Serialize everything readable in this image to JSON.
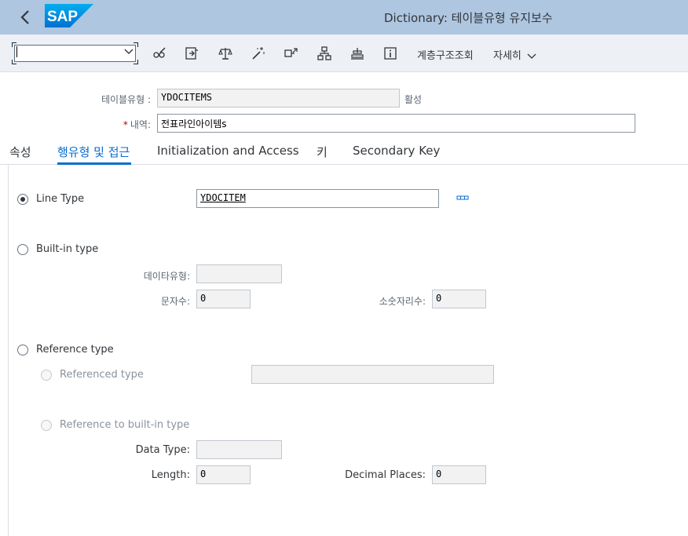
{
  "shell": {
    "title": "Dictionary: 테이블유형 유지보수",
    "logo_text": "SAP"
  },
  "toolbar": {
    "tcode_value": "",
    "icons": [
      "glasses-edit-icon",
      "activate-icon",
      "check-balance-icon",
      "magic-wand-icon",
      "where-used-icon",
      "hierarchy-icon",
      "object-list-icon",
      "info-icon"
    ],
    "hierarchy_label": "계층구조조회",
    "more_label": "자세히"
  },
  "header": {
    "table_type_label": "테이블유형 :",
    "table_type_value": "YDOCITEMS",
    "status": "활성",
    "desc_required": "*",
    "desc_label": "내역:",
    "desc_value": "전표라인아이템s"
  },
  "tabs": [
    {
      "label": "속성"
    },
    {
      "label": "행유형 및 접근"
    },
    {
      "label": "Initialization and Access"
    },
    {
      "label": "키"
    },
    {
      "label": "Secondary Key"
    }
  ],
  "active_tab": 1,
  "line_type": {
    "label": "Line Type",
    "value": "YDOCITEM",
    "selected": true
  },
  "builtin": {
    "label": "Built-in type",
    "data_type_label": "데이타유형:",
    "data_type_value": "",
    "length_label": "문자수:",
    "length_value": "0",
    "decimals_label": "소숫자리수:",
    "decimals_value": "0"
  },
  "reference": {
    "label": "Reference type",
    "referenced_type_label": "Referenced type",
    "referenced_type_value": "",
    "ref_builtin_label": "Reference to built-in type",
    "data_type_label": "Data Type:",
    "data_type_value": "",
    "length_label": "Length:",
    "length_value": "0",
    "decimals_label": "Decimal Places:",
    "decimals_value": "0"
  },
  "colors": {
    "shell_bg": "#aec6e0",
    "toolbar_bg": "#edf1f6",
    "accent": "#0a6ed1",
    "sap_blue": "#0070d2"
  }
}
